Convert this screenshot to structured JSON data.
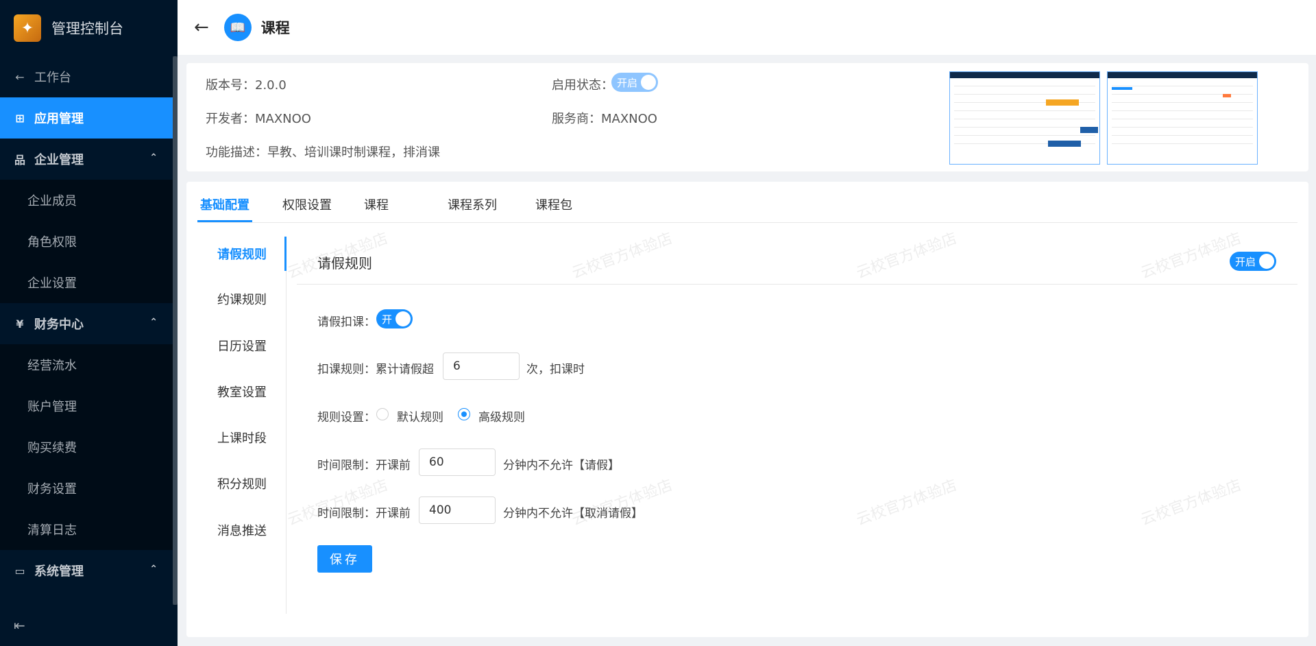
{
  "sidebar": {
    "brand": "管理控制台",
    "logo_glyph": "✦",
    "items": [
      {
        "label": "工作台",
        "icon": "←"
      },
      {
        "label": "应用管理",
        "icon": "⊞"
      },
      {
        "label": "企业管理",
        "icon": "品"
      },
      {
        "label": "企业成员"
      },
      {
        "label": "角色权限"
      },
      {
        "label": "企业设置"
      },
      {
        "label": "财务中心",
        "icon": "¥"
      },
      {
        "label": "经营流水"
      },
      {
        "label": "账户管理"
      },
      {
        "label": "购买续费"
      },
      {
        "label": "财务设置"
      },
      {
        "label": "清算日志"
      },
      {
        "label": "系统管理",
        "icon": "▭"
      }
    ],
    "arrow": "⌃",
    "collapse_icon": "⇤"
  },
  "header": {
    "back": "←",
    "app_glyph": "📖",
    "title": "课程"
  },
  "info": {
    "version": "版本号：2.0.0",
    "developer": "开发者：MAXNOO",
    "desc": "功能描述：早教、培训课时制课程，排消课",
    "status_label": "启用状态：",
    "status_toggle": "开启",
    "provider": "服务商：MAXNOO"
  },
  "tabs": [
    "基础配置",
    "权限设置",
    "课程",
    "课程系列",
    "课程包"
  ],
  "side_nav": [
    "请假规则",
    "约课规则",
    "日历设置",
    "教室设置",
    "上课时段",
    "积分规则",
    "消息推送"
  ],
  "section": {
    "title": "请假规则",
    "toggle": "开启"
  },
  "form": {
    "deduct_label": "请假扣课：",
    "deduct_toggle": "开",
    "rule_label": "扣课规则：累计请假超",
    "rule_value": "6",
    "rule_suffix": "次，扣课时",
    "setting_label": "规则设置：",
    "option_default": "默认规则",
    "option_advanced": "高级规则",
    "limit1_label": "时间限制：开课前",
    "limit1_value": "60",
    "limit1_suffix": "分钟内不允许【请假】",
    "limit2_label": "时间限制：开课前",
    "limit2_value": "400",
    "limit2_suffix": "分钟内不允许【取消请假】",
    "save": "保存"
  },
  "watermark": "云校官方体验店",
  "colors": {
    "primary": "#1890ff",
    "sidebar": "#001529"
  }
}
